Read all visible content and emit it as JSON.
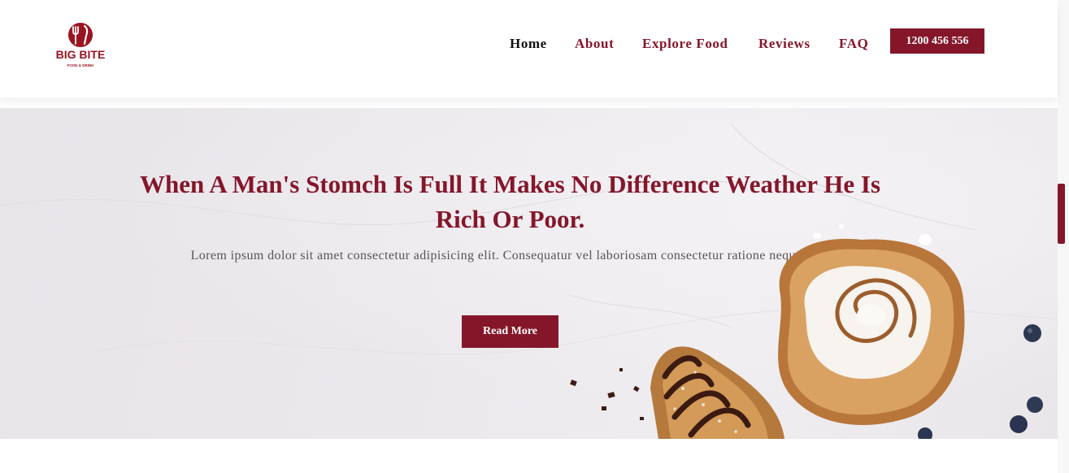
{
  "brand": {
    "logo_text": "BIG BITE",
    "logo_subtext": "FOOD & DRINK",
    "color": "#85162a"
  },
  "nav": {
    "items": [
      {
        "label": "Home",
        "active": true
      },
      {
        "label": "About",
        "active": false
      },
      {
        "label": "Explore Food",
        "active": false
      },
      {
        "label": "Reviews",
        "active": false
      },
      {
        "label": "FAQ",
        "active": false
      }
    ],
    "phone_label": "1200 456 556"
  },
  "hero": {
    "title": "When A Man's Stomch Is Full It Makes No Difference Weather He Is Rich Or Poor.",
    "text": "Lorem ipsum dolor sit amet consectetur adipisicing elit. Consequatur vel laboriosam consectetur ratione neque non.",
    "button_label": "Read More",
    "image": "cinnamon-roll-and-chocolate-pastry"
  },
  "colors": {
    "accent": "#85162a",
    "text": "#555555",
    "active_nav": "#111111"
  }
}
